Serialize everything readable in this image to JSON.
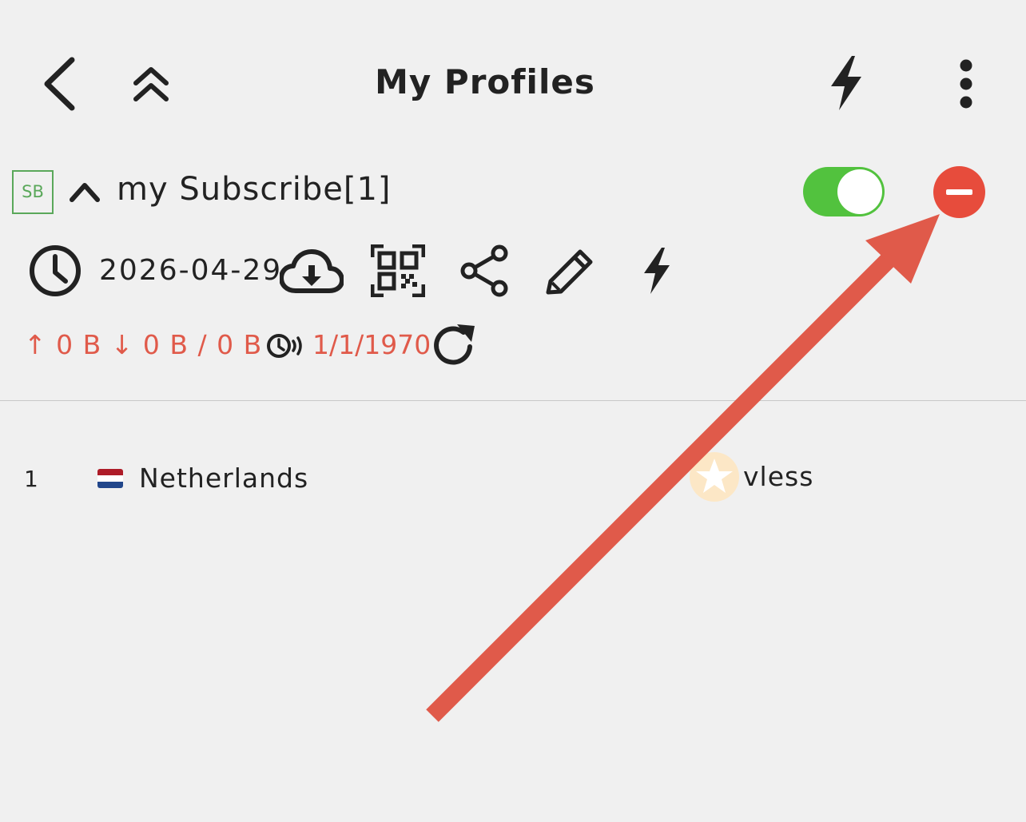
{
  "header": {
    "title": "My Profiles",
    "back_icon": "chevron-left-icon",
    "collapse_all_icon": "double-chevron-up-icon",
    "speed_test_icon": "bolt-icon",
    "more_icon": "more-vertical-icon"
  },
  "group": {
    "badge": "SB",
    "name": "my Subscribe[1]",
    "enabled": true,
    "toggle_color": "#52c23e",
    "remove_color": "#e74c3c",
    "update_date": "2026-04-29",
    "actions": [
      "clock-icon",
      "cloud-download-icon",
      "qr-code-icon",
      "share-icon",
      "edit-icon",
      "bolt-icon"
    ],
    "traffic": "↑ 0 B ↓ 0 B / 0 B",
    "expire_date": "1/1/1970",
    "traffic_color": "#e05a4a"
  },
  "profiles": [
    {
      "index": "1",
      "country": "Netherlands",
      "flag_colors": [
        "#ae1c28",
        "#ffffff",
        "#21468b"
      ],
      "type": "vless"
    }
  ],
  "annotation": {
    "arrow_color": "#e05a4a"
  }
}
